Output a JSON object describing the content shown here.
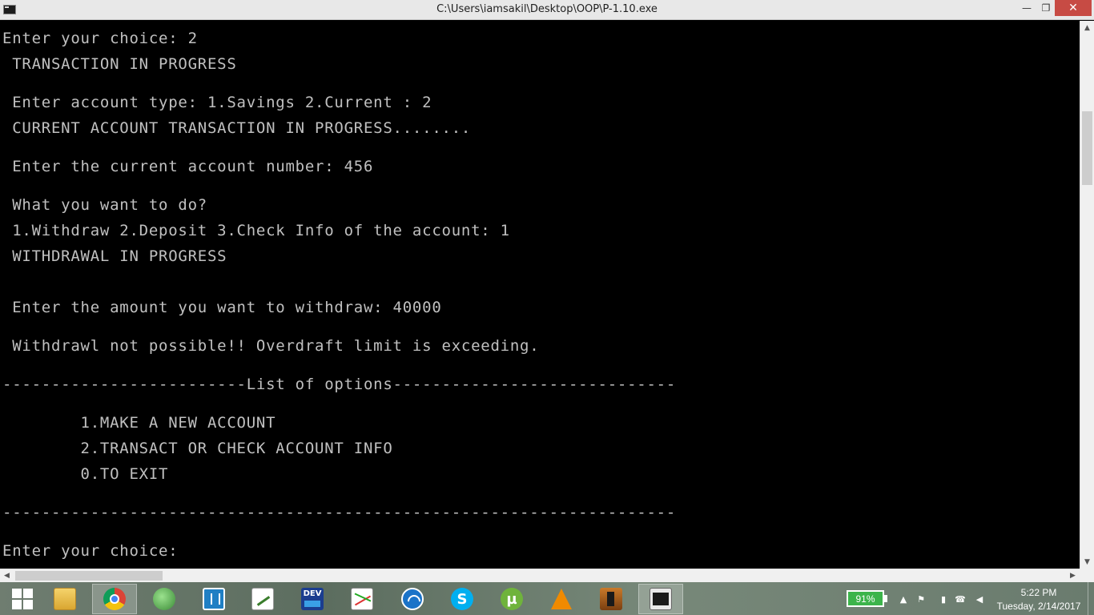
{
  "window": {
    "title": "C:\\Users\\iamsakil\\Desktop\\OOP\\P-1.10.exe",
    "minimize_glyph": "—",
    "maximize_glyph": "❐",
    "close_glyph": "✕"
  },
  "console": {
    "lines": [
      "Enter your choice: 2",
      " TRANSACTION IN PROGRESS",
      " Enter account type: 1.Savings 2.Current : 2",
      " CURRENT ACCOUNT TRANSACTION IN PROGRESS........",
      " Enter the current account number: 456",
      " What you want to do?",
      " 1.Withdraw 2.Deposit 3.Check Info of the account: 1",
      " WITHDRAWAL IN PROGRESS",
      " Enter the amount you want to withdraw: 40000",
      " Withdrawl not possible!! Overdraft limit is exceeding.",
      "-------------------------List of options-----------------------------",
      "        1.MAKE A NEW ACCOUNT",
      "        2.TRANSACT OR CHECK ACCOUNT INFO",
      "        0.TO EXIT",
      "---------------------------------------------------------------------",
      "Enter your choice:"
    ],
    "text_color": "#c0c0c0",
    "background": "#000000"
  },
  "scrollbars": {
    "up_glyph": "▲",
    "down_glyph": "▼",
    "left_glyph": "◀",
    "right_glyph": "▶"
  },
  "taskbar": {
    "apps": [
      {
        "name": "start-icon"
      },
      {
        "name": "file-explorer-icon"
      },
      {
        "name": "chrome-icon"
      },
      {
        "name": "globe-app-icon"
      },
      {
        "name": "bracket-editor-icon"
      },
      {
        "name": "code-editor-icon"
      },
      {
        "name": "dev-cpp-icon",
        "label": "DEV"
      },
      {
        "name": "graph-app-icon"
      },
      {
        "name": "wifi-app-icon"
      },
      {
        "name": "skype-icon",
        "label": "S"
      },
      {
        "name": "utorrent-icon",
        "label": "µ"
      },
      {
        "name": "vlc-icon"
      },
      {
        "name": "counter-strike-icon"
      },
      {
        "name": "console-window-icon"
      }
    ],
    "battery": "91%",
    "tray_icons": [
      "chevron-up-icon",
      "flag-icon",
      "power-icon",
      "network-icon",
      "volume-icon"
    ],
    "tray_glyphs": [
      "▲",
      "⚑",
      "▮",
      "☎",
      "◀"
    ],
    "clock_time": "5:22 PM",
    "clock_date": "Tuesday, 2/14/2017"
  }
}
